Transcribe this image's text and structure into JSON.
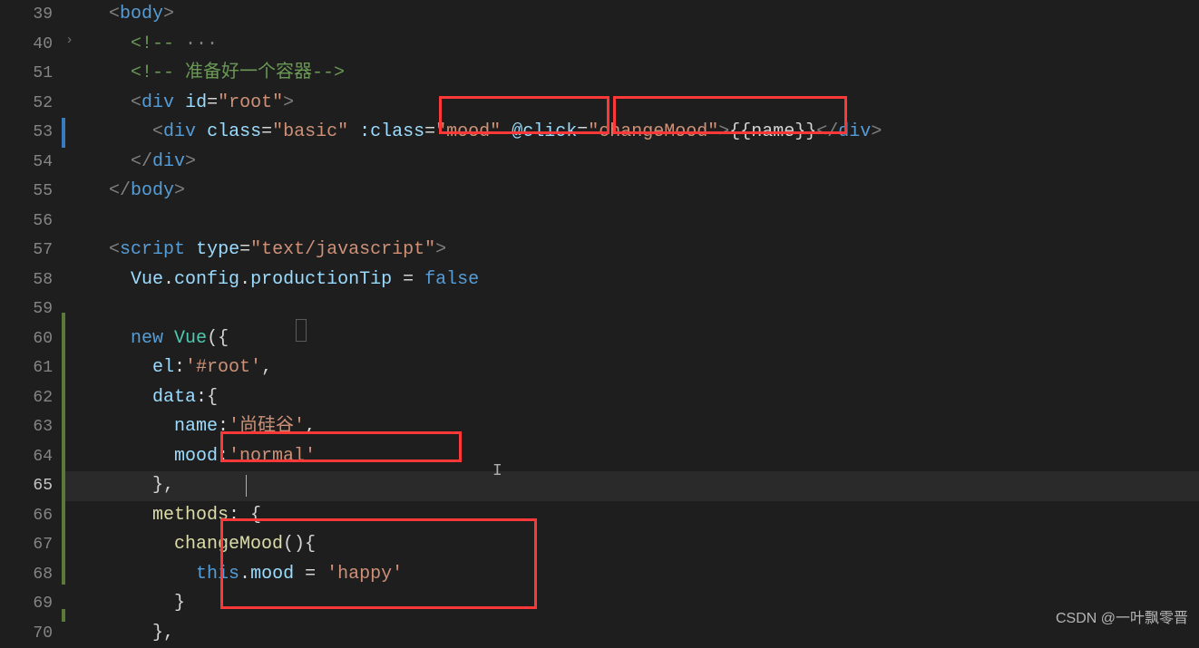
{
  "gutter": {
    "numbers": [
      "39",
      "40",
      "51",
      "52",
      "53",
      "54",
      "55",
      "56",
      "57",
      "58",
      "59",
      "60",
      "61",
      "62",
      "63",
      "64",
      "65",
      "66",
      "67",
      "68",
      "69",
      "70"
    ],
    "activeLine": "65"
  },
  "code": {
    "l39_1": "<",
    "l39_2": "body",
    "l39_3": ">",
    "l40_1": "<!-- ",
    "l40_dots": "···",
    "l51_1": "<!-- 准备好一个容器-->",
    "l52_1": "<",
    "l52_2": "div",
    "l52_3": " ",
    "l52_4": "id",
    "l52_5": "=",
    "l52_6": "\"root\"",
    "l52_7": ">",
    "l53_1": "<",
    "l53_2": "div",
    "l53_3": " ",
    "l53_4": "class",
    "l53_5": "=",
    "l53_6": "\"basic\"",
    "l53_7": " ",
    "l53_8": ":class",
    "l53_9": "=",
    "l53_10": "\"mood\"",
    "l53_11": " ",
    "l53_12": "@click",
    "l53_13": "=",
    "l53_14": "\"changeMood\"",
    "l53_15": ">",
    "l53_16": "{{name}}",
    "l53_17": "</",
    "l53_18": "div",
    "l53_19": ">",
    "l54_1": "</",
    "l54_2": "div",
    "l54_3": ">",
    "l55_1": "</",
    "l55_2": "body",
    "l55_3": ">",
    "l57_1": "<",
    "l57_2": "script",
    "l57_3": " ",
    "l57_4": "type",
    "l57_5": "=",
    "l57_6": "\"text/javascript\"",
    "l57_7": ">",
    "l58_1": "Vue",
    "l58_2": ".",
    "l58_3": "config",
    "l58_4": ".",
    "l58_5": "productionTip",
    "l58_6": " = ",
    "l58_7": "false",
    "l60_1": "new",
    "l60_2": " ",
    "l60_3": "Vue",
    "l60_4": "(",
    "l60_5": "{",
    "l61_1": "el",
    "l61_2": ":",
    "l61_3": "'#root'",
    "l61_4": ",",
    "l62_1": "data",
    "l62_2": ":{",
    "l63_1": "name",
    "l63_2": ":",
    "l63_3": "'尚硅谷'",
    "l63_4": ",",
    "l64_1": "mood",
    "l64_2": ":",
    "l64_3": "'normal'",
    "l65_1": "},",
    "l66_1": "methods",
    "l66_2": ": {",
    "l67_1": "changeMood",
    "l67_2": "(){",
    "l68_1": "this",
    "l68_2": ".",
    "l68_3": "mood",
    "l68_4": " = ",
    "l68_5": "'happy'",
    "l69_1": "}",
    "l70_1": "},"
  },
  "watermark": "CSDN @一叶飘零晋",
  "indent": {
    "s2": "  ",
    "s3": "    ",
    "s4": "      ",
    "s5": "        ",
    "s6": "          "
  }
}
